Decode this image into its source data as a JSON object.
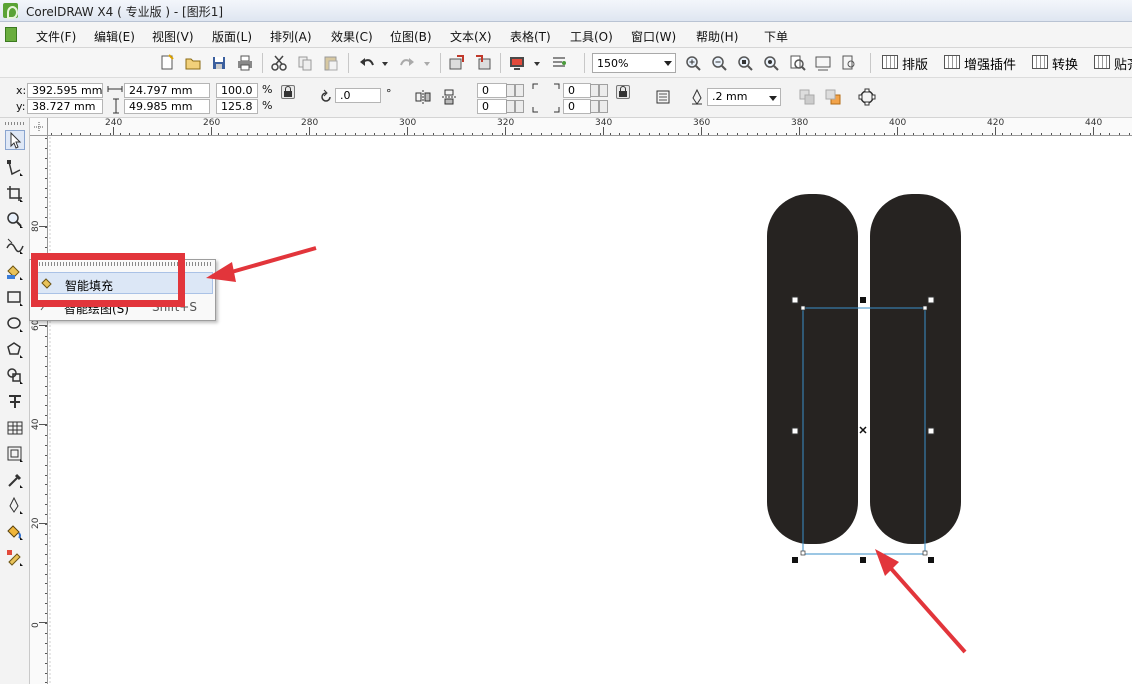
{
  "window": {
    "title": "CorelDRAW X4 ( 专业版 ) - [图形1]"
  },
  "menu": [
    "文件(F)",
    "编辑(E)",
    "视图(V)",
    "版面(L)",
    "排列(A)",
    "效果(C)",
    "位图(B)",
    "文本(X)",
    "表格(T)",
    "工具(O)",
    "窗口(W)",
    "帮助(H)",
    "下单"
  ],
  "toolbar": {
    "zoom": "150%",
    "plugins": [
      "排版",
      "增强插件",
      "转换",
      "贴齐"
    ]
  },
  "property_bar": {
    "x_label": "x:",
    "x": "392.595 mm",
    "y_label": "y:",
    "y": "38.727 mm",
    "width": "24.797 mm",
    "height": "49.985 mm",
    "scale_x": "100.0",
    "scale_y": "125.8",
    "percent": "%",
    "rotation": ".0",
    "degree": "°",
    "pos_a1": "0",
    "pos_a2": "0",
    "pos_b1": "0",
    "pos_b2": "0",
    "outline": ".2 mm"
  },
  "ruler": {
    "top_labels": [
      "240",
      "260",
      "280",
      "300",
      "320",
      "340",
      "360",
      "380",
      "400",
      "420",
      "440"
    ],
    "left_labels": [
      "80",
      "60",
      "40",
      "20",
      "0"
    ]
  },
  "flyout": {
    "items": [
      {
        "label": "智能填充",
        "shortcut": ""
      },
      {
        "label": "智能绘图(S)",
        "shortcut": "Shift+S"
      }
    ]
  },
  "colors": {
    "shape_fill": "#262321",
    "selection": "#3a8fc9",
    "highlight": "#e2353b"
  }
}
